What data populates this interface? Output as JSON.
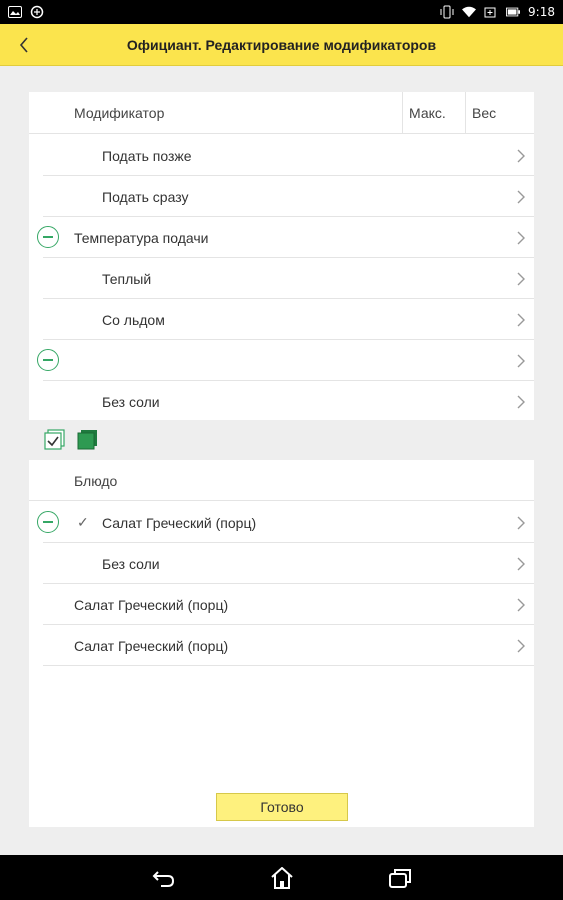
{
  "status_bar": {
    "time": "9:18",
    "icons_left": [
      "gallery-icon",
      "sync-icon"
    ],
    "icons_right": [
      "vibrate-icon",
      "wifi-icon",
      "battery-saver-icon",
      "battery-icon"
    ]
  },
  "header": {
    "title": "Официант.  Редактирование модификаторов",
    "back_icon": "chevron-left-icon"
  },
  "modifiers": {
    "columns": [
      "Модификатор",
      "Макс.",
      "Вес"
    ],
    "rows": [
      {
        "label": "Подать позже",
        "indent": 2,
        "collapse": false
      },
      {
        "label": "Подать сразу",
        "indent": 2,
        "collapse": false
      },
      {
        "label": "Температура подачи",
        "indent": 1,
        "collapse": true
      },
      {
        "label": "Теплый",
        "indent": 2,
        "collapse": false
      },
      {
        "label": "Со льдом",
        "indent": 2,
        "collapse": false
      },
      {
        "label": "",
        "indent": 1,
        "collapse": true
      },
      {
        "label": "Без соли",
        "indent": 2,
        "collapse": false
      }
    ]
  },
  "toolbar": {
    "icons": [
      "check-list-icon",
      "green-stack-icon"
    ]
  },
  "dishes": {
    "header": "Блюдо",
    "rows": [
      {
        "label": "Салат Греческий (порц)",
        "indent": 2,
        "collapse": true,
        "checked": true
      },
      {
        "label": "Без соли",
        "indent": 2,
        "collapse": false,
        "checked": false
      },
      {
        "label": "Салат Греческий (порц)",
        "indent": 1,
        "collapse": false,
        "checked": false
      },
      {
        "label": "Салат Греческий (порц)",
        "indent": 1,
        "collapse": false,
        "checked": false
      }
    ]
  },
  "done_label": "Готово",
  "navigation": {
    "icons": [
      "back-nav-icon",
      "home-nav-icon",
      "recents-nav-icon"
    ]
  },
  "colors": {
    "accent": "#fbe44d",
    "collapse": "#35a765",
    "button": "#fef17e"
  }
}
